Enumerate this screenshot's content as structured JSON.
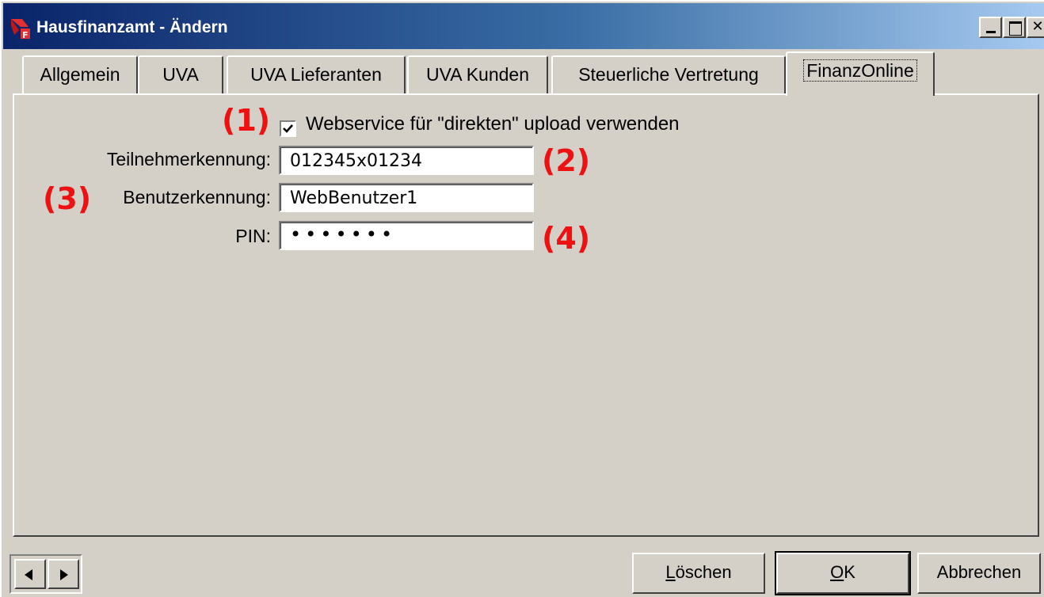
{
  "window": {
    "title": "Hausfinanzamt - Ändern",
    "caption_buttons": [
      "minimize",
      "maximize",
      "close"
    ]
  },
  "tabs": [
    {
      "label": "Allgemein"
    },
    {
      "label": "UVA"
    },
    {
      "label": "UVA Lieferanten"
    },
    {
      "label": "UVA Kunden"
    },
    {
      "label": "Steuerliche Vertretung"
    },
    {
      "label": "FinanzOnline",
      "active": true
    }
  ],
  "form": {
    "webservice_checkbox": {
      "label": "Webservice für \"direkten\" upload verwenden",
      "checked": true
    },
    "teilnehmer": {
      "label": "Teilnehmerkennung:",
      "value": "012345x01234"
    },
    "benutzer": {
      "label": "Benutzerkennung:",
      "value": "WebBenutzer1"
    },
    "pin": {
      "label": "PIN:",
      "value": "•••••••"
    }
  },
  "annotations": [
    "(1)",
    "(2)",
    "(3)",
    "(4)"
  ],
  "annotation_color": "#ee1111",
  "footer": {
    "prev_icon": "arrow-left-icon",
    "next_icon": "arrow-right-icon",
    "delete_prefix": "",
    "delete_underlined": "L",
    "delete_rest": "öschen",
    "ok_underlined": "O",
    "ok_rest": "K",
    "cancel_label": "Abbrechen"
  }
}
